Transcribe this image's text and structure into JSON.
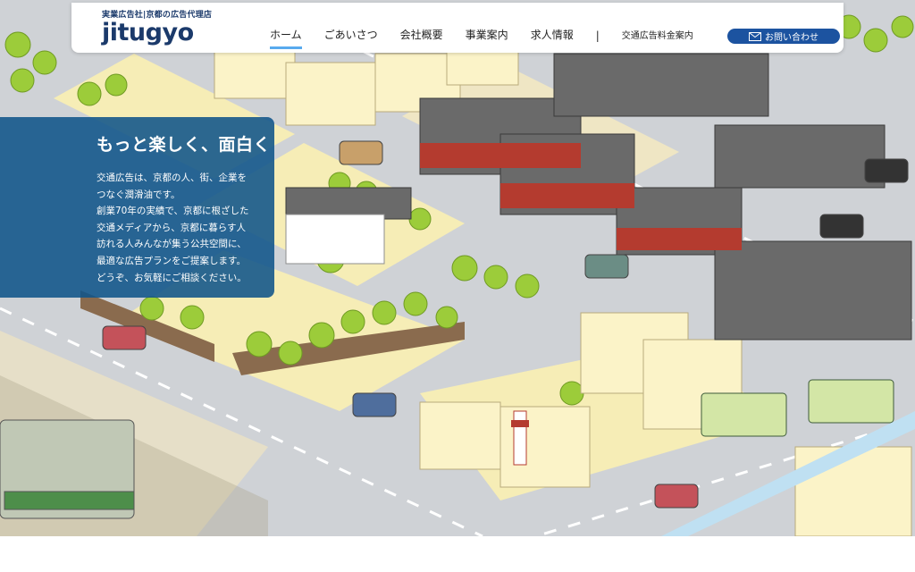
{
  "logo": {
    "tagline": "実業広告社|京都の広告代理店",
    "wordmark": "jitugyo"
  },
  "nav": {
    "items": [
      "ホーム",
      "ごあいさつ",
      "会社概要",
      "事業案内",
      "求人情報"
    ],
    "separator": "|",
    "rates_label": "交通広告料金案内",
    "contact_label": "お問い合わせ"
  },
  "hero": {
    "title": "もっと楽しく、面白く",
    "lines": [
      "交通広告は、京都の人、街、企業を",
      "つなぐ潤滑油です。",
      "創業70年の実績で、京都に根ざした",
      "交通メディアから、京都に暮らす人",
      "訪れる人みんなが集う公共空間に、",
      "最適な広告プランをご提案します。",
      "どうぞ、お気軽にご相談ください。"
    ]
  },
  "colors": {
    "brand": "#1b3a6b",
    "button": "#1c53a0",
    "overlay": "#10548a",
    "road": "#cfd2d6",
    "block": "#f6edb6",
    "tree": "#9ccc3a",
    "roof": "#6a6a6a"
  },
  "icons": {
    "contact": "mail-icon"
  }
}
